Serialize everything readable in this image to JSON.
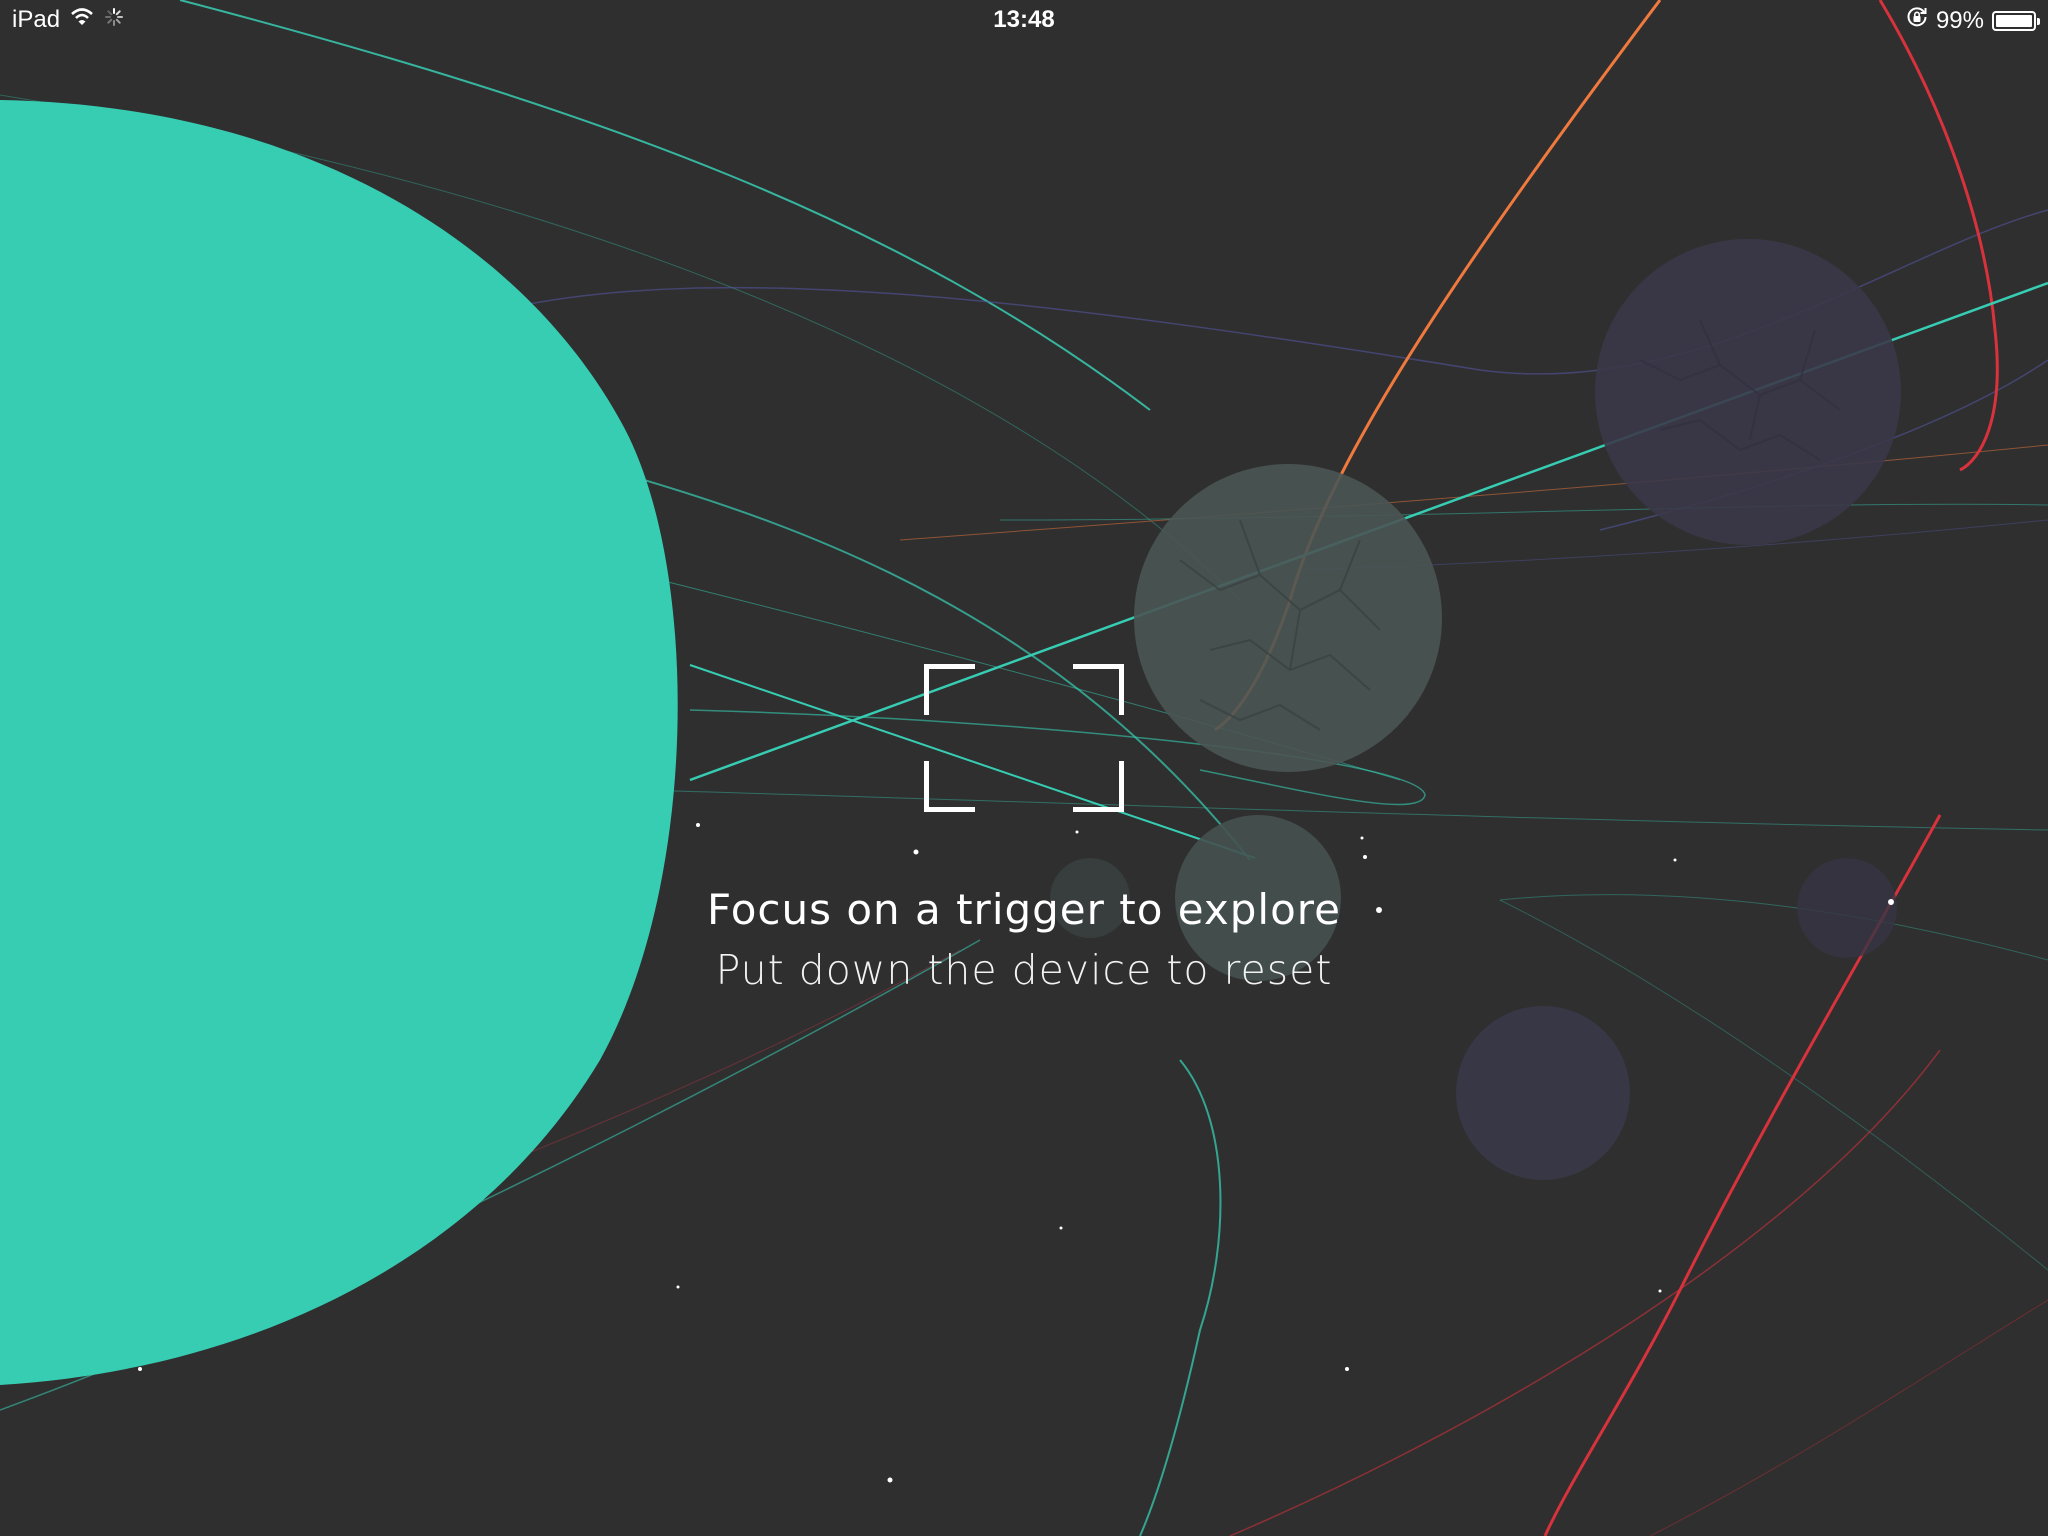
{
  "status_bar": {
    "device": "iPad",
    "time": "13:48",
    "battery_percent": "99%",
    "battery_level": 0.99,
    "icons": [
      "wifi-icon",
      "activity-spinner-icon",
      "rotation-lock-icon",
      "battery-icon"
    ]
  },
  "instructions": {
    "primary": "Focus on a trigger to explore",
    "secondary": "Put down the device to reset"
  },
  "colors": {
    "background": "#2f2f2f",
    "planet_teal": "#37cdb3",
    "orbit_orange": "#f07a3e",
    "orbit_red": "#d8323c",
    "text": "#ffffff"
  }
}
